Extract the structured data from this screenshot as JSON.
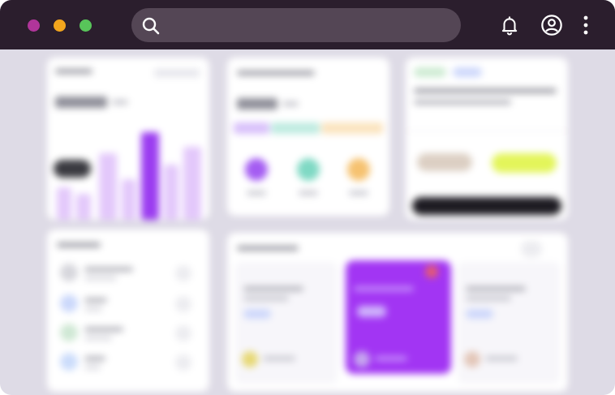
{
  "search": {
    "placeholder": ""
  },
  "topbar": {
    "icons": [
      "bell-icon",
      "user-circle-icon",
      "more-vertical-icon"
    ]
  },
  "colors": {
    "titlebar": "#2b1e2d",
    "search_bg": "#544655",
    "accent_purple": "#9b3cf0",
    "light_purple": "#e3c8fb",
    "teal": "#7fd9c4",
    "orange": "#f6c270",
    "lime": "#e3f55a",
    "content_bg": "#dedbe6"
  },
  "content": {
    "note": ""
  }
}
